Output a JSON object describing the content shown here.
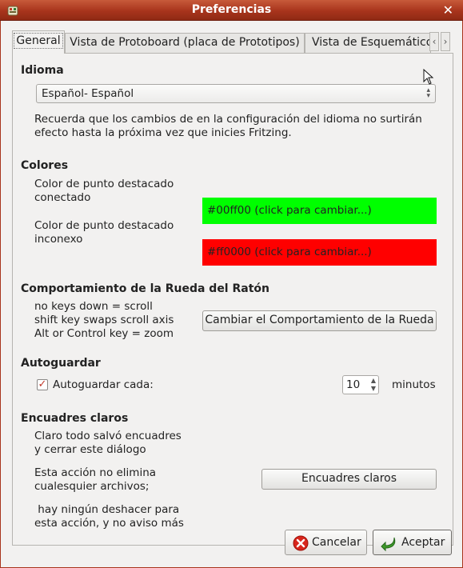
{
  "window": {
    "title": "Preferencias",
    "close_glyph": "✕",
    "accent_color": "#a8341c"
  },
  "tabs": {
    "items": [
      {
        "label": "General",
        "active": true
      },
      {
        "label": "Vista de Protoboard (placa de Prototipos)",
        "active": false
      },
      {
        "label": "Vista de Esquemático",
        "active": false
      }
    ],
    "left_arrow": "‹",
    "right_arrow": "›"
  },
  "language": {
    "heading": "Idioma",
    "selected": "Español- Español",
    "note_line1": "Recuerda que los cambios de en la configuración del idioma no surtirán",
    "note_line2": "efecto hasta la próxima vez que inicies Fritzing."
  },
  "colors": {
    "heading": "Colores",
    "connected_label_line1": "Color de punto destacado",
    "connected_label_line2": "conectado",
    "connected_value": "#00ff00 (click para cambiar...)",
    "connected_color": "#00ff00",
    "unconnected_label_line1": "Color de punto destacado",
    "unconnected_label_line2": "inconexo",
    "unconnected_value": "#ff0000 (click para cambiar...)",
    "unconnected_color": "#ff0000"
  },
  "wheel": {
    "heading": "Comportamiento de la Rueda del Ratón",
    "line1": "no keys down = scroll",
    "line2": "shift key swaps scroll axis",
    "line3": "Alt or Control key = zoom",
    "button": "Cambiar el Comportamiento de la Rueda"
  },
  "autosave": {
    "heading": "Autoguardar",
    "checkbox_label": "Autoguardar cada:",
    "checked": true,
    "value": "10",
    "unit": "minutos"
  },
  "clear": {
    "heading": "Encuadres claros",
    "line1": "Claro todo salvó encuadres",
    "line2": "y cerrar este diálogo",
    "line3": "Esta acción no elimina",
    "line4": "cualesquier archivos;",
    "line5": " hay ningún deshacer para",
    "line6": "esta acción, y no aviso más",
    "button": "Encuadres claros"
  },
  "footer": {
    "cancel": "Cancelar",
    "accept": "Aceptar"
  },
  "icons": {
    "app": "fritzing-app-icon",
    "close": "close-icon",
    "cancel": "cancel-icon",
    "accept": "accept-icon",
    "cursor": "mouse-cursor-icon"
  }
}
